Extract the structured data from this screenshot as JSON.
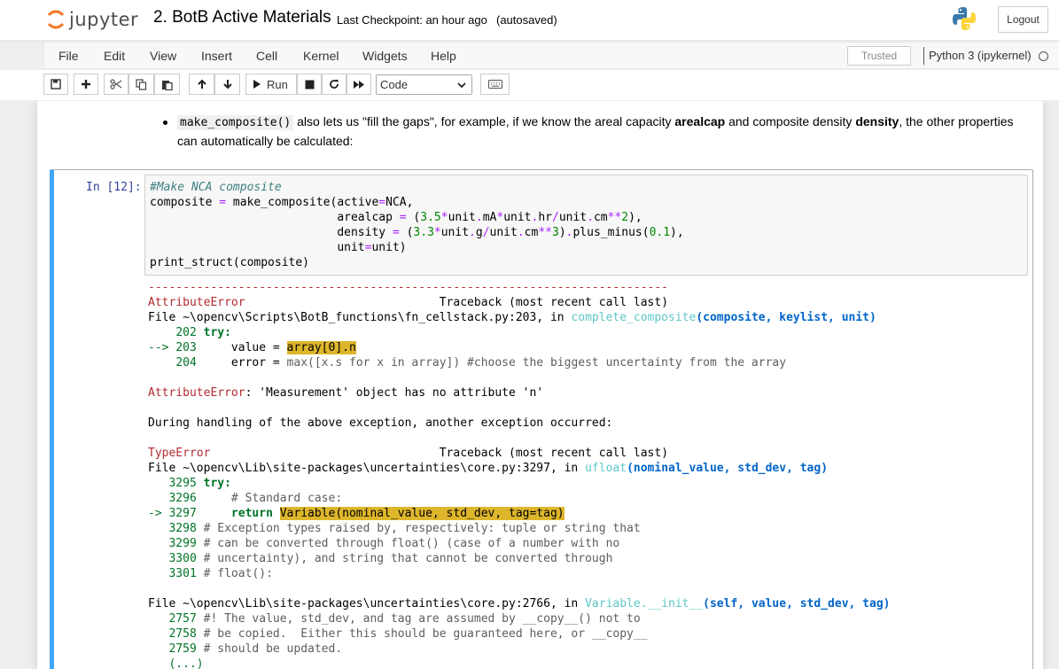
{
  "header": {
    "logo_text": "jupyter",
    "notebook_name": "2. BotB Active Materials",
    "checkpoint": "Last Checkpoint: an hour ago",
    "autosave": "(autosaved)",
    "logout_label": "Logout"
  },
  "menubar": {
    "items": [
      "File",
      "Edit",
      "View",
      "Insert",
      "Cell",
      "Kernel",
      "Widgets",
      "Help"
    ],
    "trusted": "Trusted",
    "kernel": "Python 3 (ipykernel)"
  },
  "toolbar": {
    "run_label": "Run",
    "cell_type": "Code",
    "buttons": [
      "save-icon",
      "plus-icon",
      "cut-icon",
      "copy-icon",
      "paste-icon",
      "arrow-up-icon",
      "arrow-down-icon",
      "run-icon",
      "stop-icon",
      "restart-icon",
      "fast-forward-icon",
      "keyboard-icon"
    ]
  },
  "markdown": {
    "code": "make_composite()",
    "text1": " also lets us \"fill the gaps\", for example, if we know the areal capacity ",
    "bold1": "arealcap",
    "text2": " and composite density ",
    "bold2": "density",
    "text3": ", the other properties can automatically be calculated:"
  },
  "cell": {
    "prompt": "In [12]:",
    "input_lines": [
      "#Make NCA composite",
      "composite = make_composite(active=NCA,",
      "                           arealcap = (3.5*unit.mA*unit.hr/unit.cm**2),",
      "                           density = (3.3*unit.g/unit.cm**3).plus_minus(0.1),",
      "                           unit=unit)",
      "print_struct(composite)"
    ],
    "output": {
      "dashes": "---------------------------------------------------------------------------",
      "err1_name": "AttributeError",
      "traceback_label": "Traceback (most recent call last)",
      "file1": "File ~\\opencv\\Scripts\\BotB_functions\\fn_cellstack.py:203, in ",
      "func1": "complete_composite",
      "args1": "(composite, keylist, unit)",
      "l202_num": "202",
      "l202": " try:",
      "l203_arrow": "--> 203",
      "l203_pre": "     value = ",
      "l203_hl": "array[0].n",
      "l204_num": "204",
      "l204_pre": "     error = ",
      "l204_rest": "max([x.s for x in array]) #choose the biggest uncertainty from the array",
      "err1_msg": ": 'Measurement' object has no attribute 'n'",
      "during": "During handling of the above exception, another exception occurred:",
      "err2_name": "TypeError",
      "file2": "File ~\\opencv\\Lib\\site-packages\\uncertainties\\core.py:3297, in ",
      "func2": "ufloat",
      "args2": "(nominal_value, std_dev, tag)",
      "l3295": "3295",
      "l3295_txt": " try:",
      "l3296": "3296",
      "l3296_txt": "     # Standard case:",
      "l3297_arrow": "-> 3297",
      "l3297_pre": "     return ",
      "l3297_hl": "Variable(nominal_value, std_dev, tag=tag)",
      "l3298": "3298",
      "l3298_txt": " # Exception types raised by, respectively: tuple or string that",
      "l3299": "3299",
      "l3299_txt": " # can be converted through float() (case of a number with no",
      "l3300": "3300",
      "l3300_txt": " # uncertainty), and string that cannot be converted through",
      "l3301": "3301",
      "l3301_txt": " # float():",
      "file3": "File ~\\opencv\\Lib\\site-packages\\uncertainties\\core.py:2766, in ",
      "func3": "Variable.__init__",
      "args3": "(self, value, std_dev, tag)",
      "l2757": "2757",
      "l2757_txt": " #! The value, std_dev, and tag are assumed by __copy__() not to",
      "l2758": "2758",
      "l2758_txt": " # be copied.  Either this should be guaranteed here, or __copy__",
      "l2759": "2759",
      "l2759_txt": " # should be updated.",
      "ellipsis": "(...)"
    }
  }
}
